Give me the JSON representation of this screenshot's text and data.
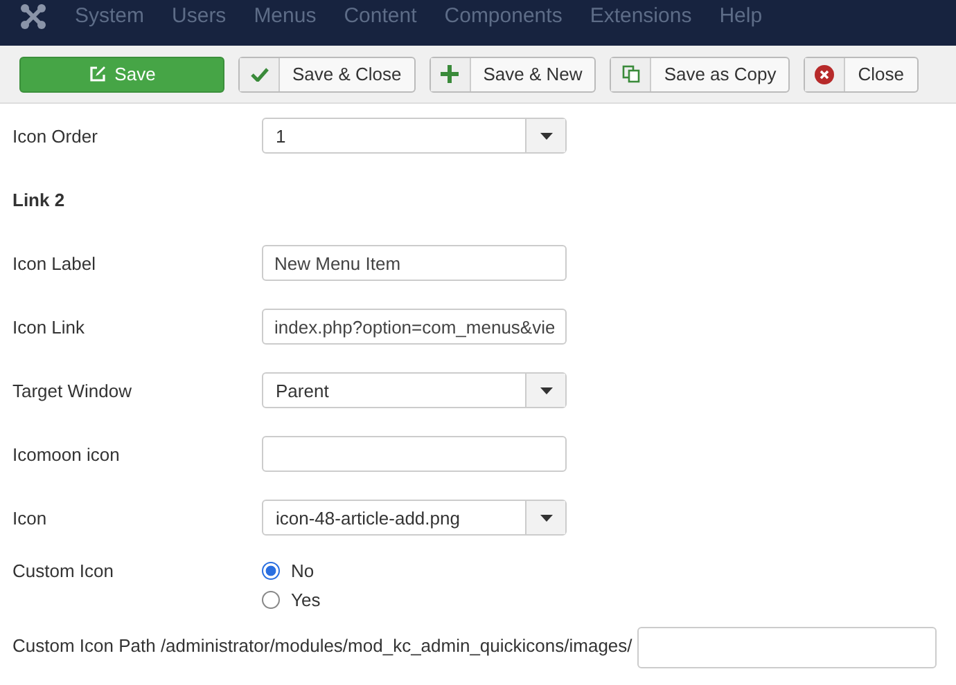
{
  "menu": [
    "System",
    "Users",
    "Menus",
    "Content",
    "Components",
    "Extensions",
    "Help"
  ],
  "toolbar": [
    {
      "label": "Save",
      "kind": "save"
    },
    {
      "label": "Save & Close",
      "kind": "apply"
    },
    {
      "label": "Save & New",
      "kind": "new"
    },
    {
      "label": "Save as Copy",
      "kind": "copy"
    },
    {
      "label": "Close",
      "kind": "cancel"
    }
  ],
  "fields": [
    {
      "kind": "select",
      "label": "Icon Order",
      "value": "1"
    },
    {
      "kind": "heading",
      "label": "Link 2"
    },
    {
      "kind": "text",
      "label": "Icon Label",
      "value": "New Menu Item"
    },
    {
      "kind": "text",
      "label": "Icon Link",
      "value": "index.php?option=com_menus&vie"
    },
    {
      "kind": "select",
      "label": "Target Window",
      "value": "Parent"
    },
    {
      "kind": "text",
      "label": "Icomoon icon"
    },
    {
      "kind": "select",
      "label": "Icon",
      "value": "icon-48-article-add.png"
    },
    {
      "kind": "radio",
      "label": "Custom Icon",
      "options": [
        {
          "label": "No",
          "selected": true
        },
        {
          "label": "Yes",
          "selected": false
        }
      ]
    },
    {
      "kind": "path",
      "label": "Custom Icon Path /administrator/modules/mod_kc_admin_quickicons/images/"
    }
  ]
}
